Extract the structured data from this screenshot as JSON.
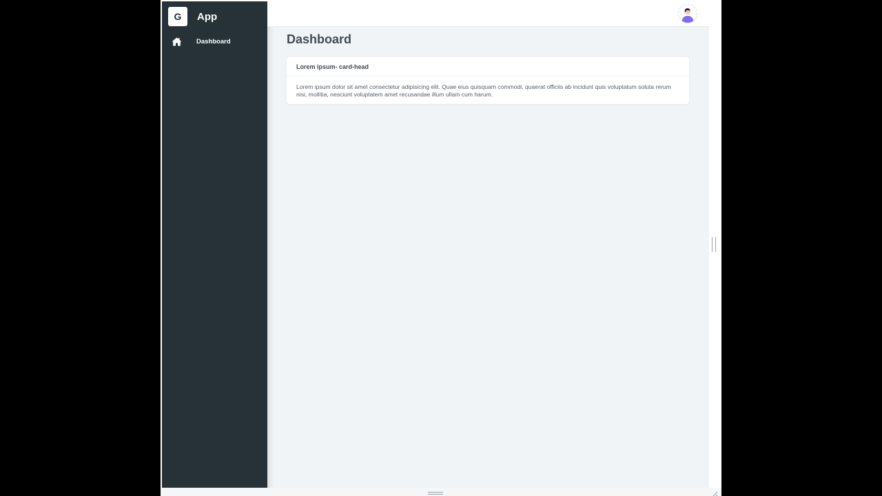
{
  "brand": {
    "logo_letter": "G",
    "name": "App"
  },
  "sidebar": {
    "items": [
      {
        "label": "Dashboard",
        "icon": "home-icon"
      }
    ]
  },
  "topbar": {
    "avatar_icon": "user-avatar"
  },
  "main": {
    "title": "Dashboard",
    "card": {
      "title": "Lorem ipsum- card-head",
      "body": "Lorem ipsum dolor sit amet consectetur adipisicing elit. Quae eius quisquam commodi, quaerat officiis ab incidunt quis voluptatum soluta rerum nisi, mollitia, nesciunt voluptatem amet recusandae illum ullam cum harum."
    }
  },
  "colors": {
    "sidebar_bg": "#263238",
    "content_bg": "#f1f4f6",
    "avatar_accent": "#7b6cf0"
  }
}
